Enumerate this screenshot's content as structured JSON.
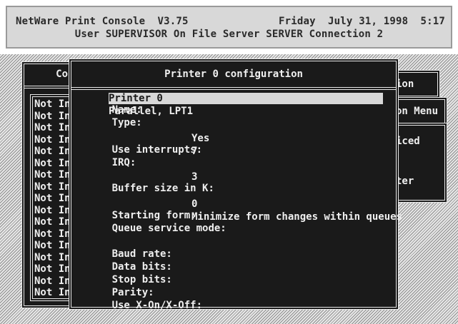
{
  "header": {
    "app": "NetWare Print Console  V3.75",
    "datetime": "Friday  July 31, 1998  5:17",
    "user_line": "User SUPERVISOR On File Server SERVER Connection 2"
  },
  "left_window": {
    "title": "Co",
    "items": [
      "Not In",
      "Not In",
      "Not In",
      "Not In",
      "Not In",
      "Not In",
      "Not In",
      "Not In",
      "Not In",
      "Not In",
      "Not In",
      "Not In",
      "Not In",
      "Not In",
      "Not In",
      "Not In",
      "Not In"
    ]
  },
  "right_menu": {
    "items": [
      "ion",
      "on Menu",
      "iced",
      "ter"
    ]
  },
  "config": {
    "title": "Printer 0 configuration",
    "fields": {
      "name": {
        "label": "Name:",
        "value": "Printer 0"
      },
      "type": {
        "label": "Type:",
        "value": "Parallel, LPT1"
      },
      "use_interrupts": {
        "label": "Use interrupts:",
        "value": "Yes"
      },
      "irq": {
        "label": "IRQ:",
        "value": "7"
      },
      "buffer_size": {
        "label": "Buffer size in K:",
        "value": "3"
      },
      "starting_form": {
        "label": "Starting form:",
        "value": "0"
      },
      "queue_service": {
        "label": "Queue service mode:",
        "value": "Minimize form changes within queues"
      },
      "baud_rate": {
        "label": "Baud rate:",
        "value": ""
      },
      "data_bits": {
        "label": "Data bits:",
        "value": ""
      },
      "stop_bits": {
        "label": "Stop bits:",
        "value": ""
      },
      "parity": {
        "label": "Parity:",
        "value": ""
      },
      "xon_xoff": {
        "label": "Use X-On/X-Off:",
        "value": ""
      }
    }
  },
  "colors": {
    "window_bg": "#1a1a1a",
    "text": "#efefef",
    "highlight_bg": "#d8d8d8",
    "header_bg": "#d8d8d8"
  }
}
